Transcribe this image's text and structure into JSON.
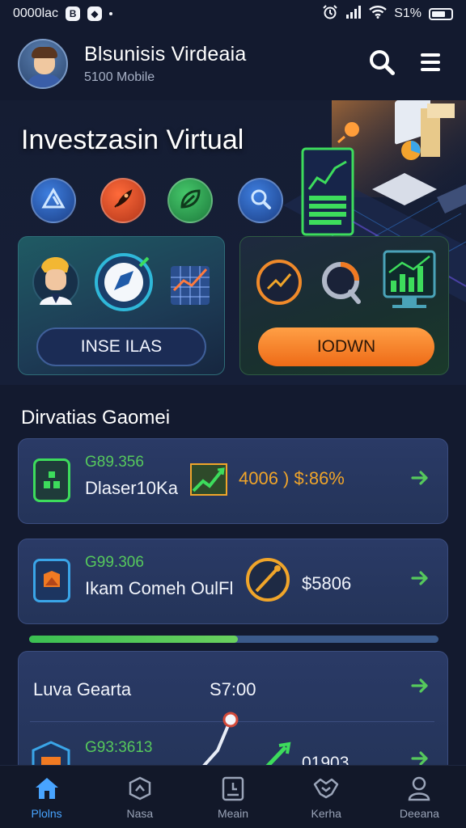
{
  "status_bar": {
    "time": "0000lac",
    "signal": "ıl",
    "battery_text": "S1%"
  },
  "header": {
    "title": "Blsunisis Virdeaia",
    "subtitle": "5100 Mobile",
    "search_icon": "search-icon",
    "menu_icon": "menu-icon"
  },
  "banner": {
    "title": "Investzasin Virtual",
    "quick_icons": [
      "triangle-icon",
      "rocket-icon",
      "leaf-icon",
      "magnifier-icon"
    ],
    "card_left_button": "INSE ILAS",
    "card_right_button": "IODWN"
  },
  "section": {
    "title": "Dirvatias Gaomei"
  },
  "list": [
    {
      "amount": "G89.356",
      "name": "Dlaser10Ka",
      "value": "4006 ) $:86%",
      "icon": "wallet-icon"
    },
    {
      "amount": "G99.306",
      "name": "Ikam Comeh OulFl",
      "value": "$5806",
      "icon": "shield-chart-icon"
    }
  ],
  "progress": {
    "fraction": 0.51
  },
  "chart_card": {
    "title": "Luva Gearta",
    "value": "S7:00",
    "row_amount": "G93:3613",
    "row_value": "01903"
  },
  "bottom_nav": [
    {
      "label": "Plolns",
      "icon": "home-icon",
      "active": true
    },
    {
      "label": "Nasa",
      "icon": "cube-icon",
      "active": false
    },
    {
      "label": "Meain",
      "icon": "calendar-icon",
      "active": false
    },
    {
      "label": "Kerha",
      "icon": "handshake-icon",
      "active": false
    },
    {
      "label": "Deeana",
      "icon": "user-icon",
      "active": false
    }
  ],
  "colors": {
    "background": "#131a2f",
    "accent_green": "#56c95c",
    "accent_orange": "#f07a22",
    "accent_blue": "#48a4ff"
  }
}
